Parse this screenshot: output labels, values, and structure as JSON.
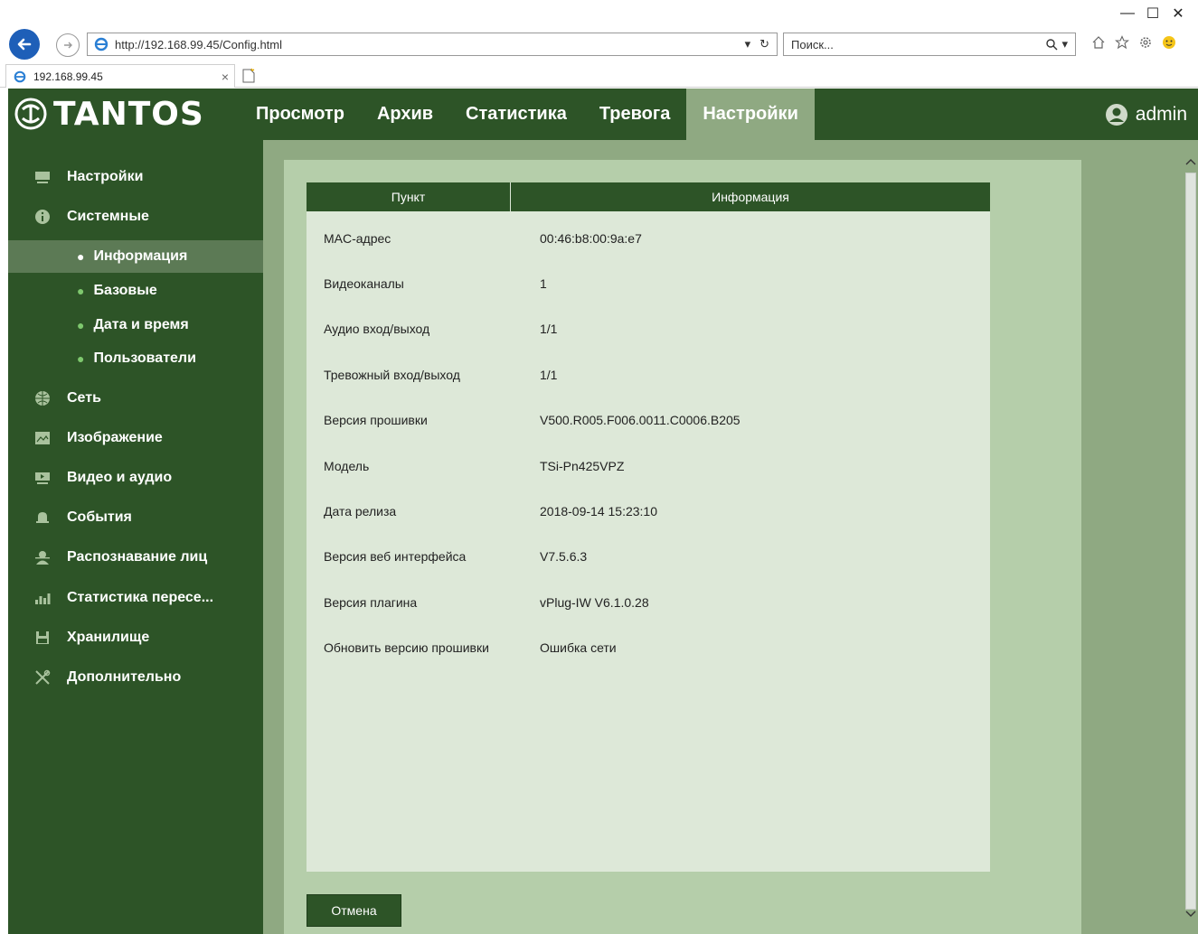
{
  "browser": {
    "url": "http://192.168.99.45/Config.html",
    "search_placeholder": "Поиск...",
    "tab_title": "192.168.99.45",
    "window_controls": [
      "minimize-icon",
      "maximize-icon",
      "close-icon"
    ],
    "toolbar_icons": [
      "home-icon",
      "star-icon",
      "gear-icon",
      "smiley-icon"
    ]
  },
  "header": {
    "logo": "TANTOS",
    "nav": [
      {
        "label": "Просмотр",
        "active": false
      },
      {
        "label": "Архив",
        "active": false
      },
      {
        "label": "Статистика",
        "active": false
      },
      {
        "label": "Тревога",
        "active": false
      },
      {
        "label": "Настройки",
        "active": true
      }
    ],
    "user": "admin"
  },
  "sidebar": {
    "items": [
      {
        "label": "Настройки",
        "icon": "settings-monitor-icon"
      },
      {
        "label": "Системные",
        "icon": "info-icon"
      },
      {
        "label": "Информация",
        "sub": true,
        "active": true
      },
      {
        "label": "Базовые",
        "sub": true
      },
      {
        "label": "Дата и время",
        "sub": true
      },
      {
        "label": "Пользователи",
        "sub": true
      },
      {
        "label": "Сеть",
        "icon": "globe-icon"
      },
      {
        "label": "Изображение",
        "icon": "image-icon"
      },
      {
        "label": "Видео и аудио",
        "icon": "video-icon"
      },
      {
        "label": "События",
        "icon": "bell-icon"
      },
      {
        "label": "Распознавание лиц",
        "icon": "face-icon"
      },
      {
        "label": "Статистика пересе...",
        "icon": "bar-chart-icon"
      },
      {
        "label": "Хранилище",
        "icon": "floppy-icon"
      },
      {
        "label": "Дополнительно",
        "icon": "tools-icon"
      }
    ]
  },
  "table": {
    "headers": [
      "Пункт",
      "Информация"
    ],
    "rows": [
      {
        "key": "MAC-адрес",
        "value": "00:46:b8:00:9a:e7"
      },
      {
        "key": "Видеоканалы",
        "value": "1"
      },
      {
        "key": "Аудио вход/выход",
        "value": "1/1"
      },
      {
        "key": "Тревожный вход/выход",
        "value": "1/1"
      },
      {
        "key": "Версия прошивки",
        "value": "V500.R005.F006.0011.C0006.B205"
      },
      {
        "key": "Модель",
        "value": "TSi-Pn425VPZ"
      },
      {
        "key": "Дата релиза",
        "value": "2018-09-14 15:23:10"
      },
      {
        "key": "Версия веб интерфейса",
        "value": "V7.5.6.3"
      },
      {
        "key": "Версия плагина",
        "value": "vPlug-IW V6.1.0.28"
      },
      {
        "key": "Обновить версию прошивки",
        "value": "Ошибка сети"
      }
    ]
  },
  "buttons": {
    "cancel": "Отмена"
  },
  "colors": {
    "header_green": "#2d5427",
    "active_tab": "#8fa982",
    "panel": "#b5ceaa",
    "table_bg": "#dde8d8"
  }
}
